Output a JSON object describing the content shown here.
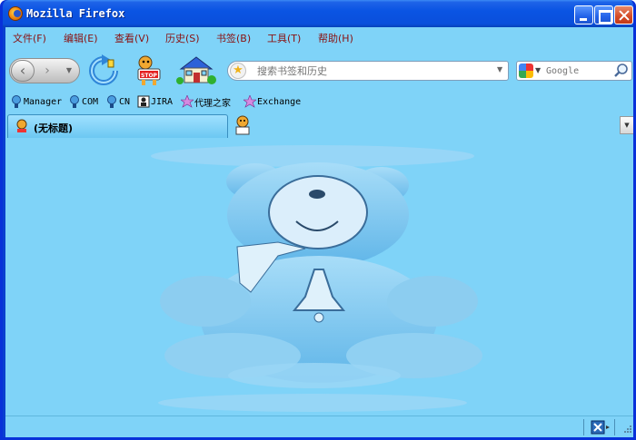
{
  "window": {
    "title": "Mozilla Firefox"
  },
  "menu": {
    "items": [
      {
        "label": "文件(F)"
      },
      {
        "label": "编辑(E)"
      },
      {
        "label": "查看(V)"
      },
      {
        "label": "历史(S)"
      },
      {
        "label": "书签(B)"
      },
      {
        "label": "工具(T)"
      },
      {
        "label": "帮助(H)"
      }
    ]
  },
  "toolbar": {
    "url_placeholder": "搜索书签和历史",
    "search_placeholder": "Google"
  },
  "bookmarks": {
    "items": [
      {
        "label": "Manager",
        "icon": "globe-icon"
      },
      {
        "label": "COM",
        "icon": "globe-icon"
      },
      {
        "label": "CN",
        "icon": "globe-icon"
      },
      {
        "label": "JIRA",
        "icon": "jira-icon"
      },
      {
        "label": "代理之家",
        "icon": "flower-icon"
      },
      {
        "label": "Exchange",
        "icon": "flower-icon"
      }
    ]
  },
  "tabs": {
    "active_label": "(无标题)"
  },
  "status": {
    "text": ""
  },
  "colors": {
    "chrome_bg": "#7fd3f8",
    "titlebar": "#0a54e3",
    "menu_text": "#8a1010"
  }
}
